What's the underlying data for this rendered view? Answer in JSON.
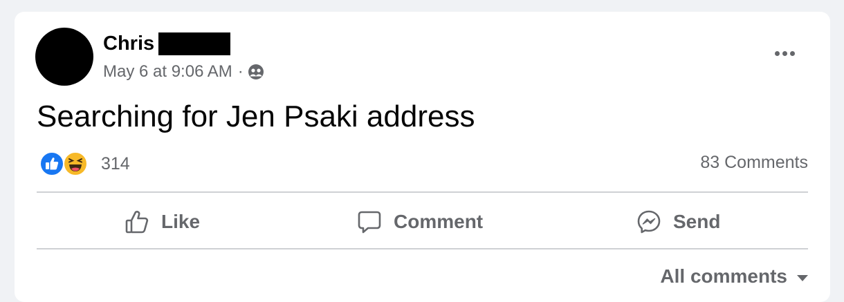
{
  "post": {
    "author_name": "Chris",
    "timestamp": "May 6 at 9:06 AM",
    "separator": "·",
    "audience_icon": "friends-icon",
    "text": "Searching for Jen Psaki address"
  },
  "engagement": {
    "reaction_icons": [
      "like-reaction-icon",
      "haha-reaction-icon"
    ],
    "reaction_count": "314",
    "comments_label": "83 Comments"
  },
  "actions": {
    "like_label": "Like",
    "comment_label": "Comment",
    "send_label": "Send"
  },
  "comments": {
    "sort_label": "All comments"
  },
  "colors": {
    "background": "#f0f2f5",
    "card": "#ffffff",
    "primary_text": "#050505",
    "secondary_text": "#65676b",
    "like_blue": "#1877f2",
    "haha_yellow": "#f7b928",
    "divider": "#ced0d4"
  }
}
